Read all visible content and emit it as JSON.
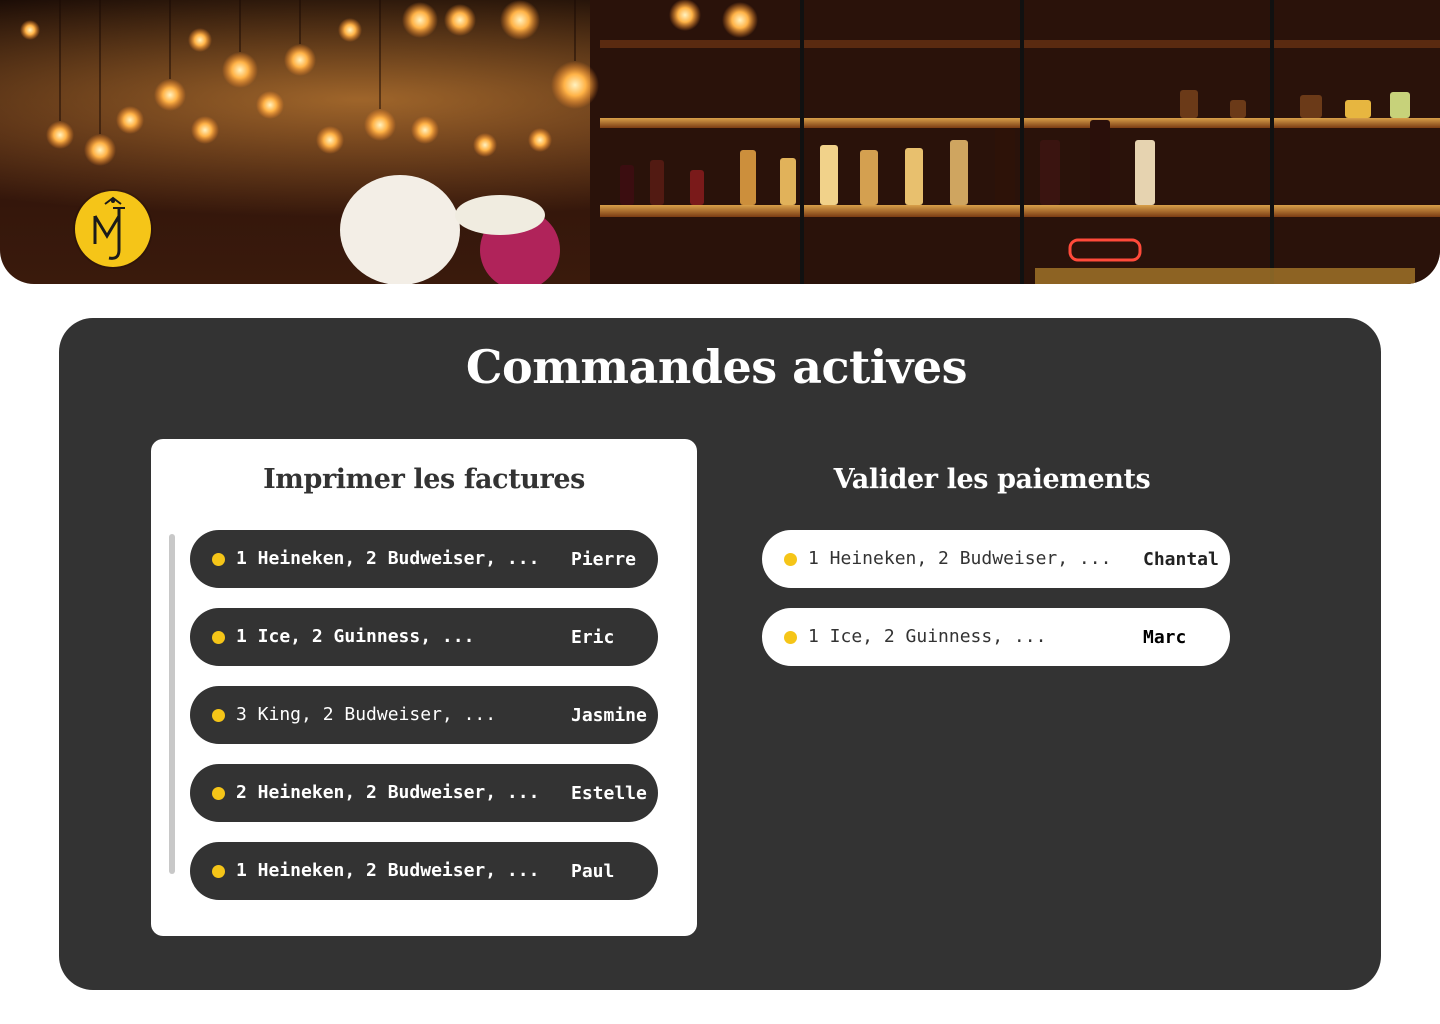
{
  "banner": {
    "logo_icon": "mj-monogram-logo",
    "logo_color": "#f5c518"
  },
  "page_title": "Commandes actives",
  "print_section": {
    "title": "Imprimer les factures",
    "orders": [
      {
        "items": "1 Heineken, 2 Budweiser, ...",
        "name": "Pierre"
      },
      {
        "items": "1 Ice, 2 Guinness, ...",
        "name": "Eric"
      },
      {
        "items": "3 King, 2 Budweiser, ...",
        "name": "Jasmine"
      },
      {
        "items": "2 Heineken, 2 Budweiser, ...",
        "name": "Estelle"
      },
      {
        "items": "1 Heineken, 2 Budweiser, ...",
        "name": "Paul"
      }
    ]
  },
  "payment_section": {
    "title": "Valider les paiements",
    "orders": [
      {
        "items": "1 Heineken, 2 Budweiser, ...",
        "name": "Chantal"
      },
      {
        "items": "1 Ice, 2 Guinness, ...",
        "name": "Marc"
      }
    ]
  },
  "colors": {
    "panel": "#333333",
    "accent_dot": "#f5c518",
    "card": "#ffffff"
  }
}
